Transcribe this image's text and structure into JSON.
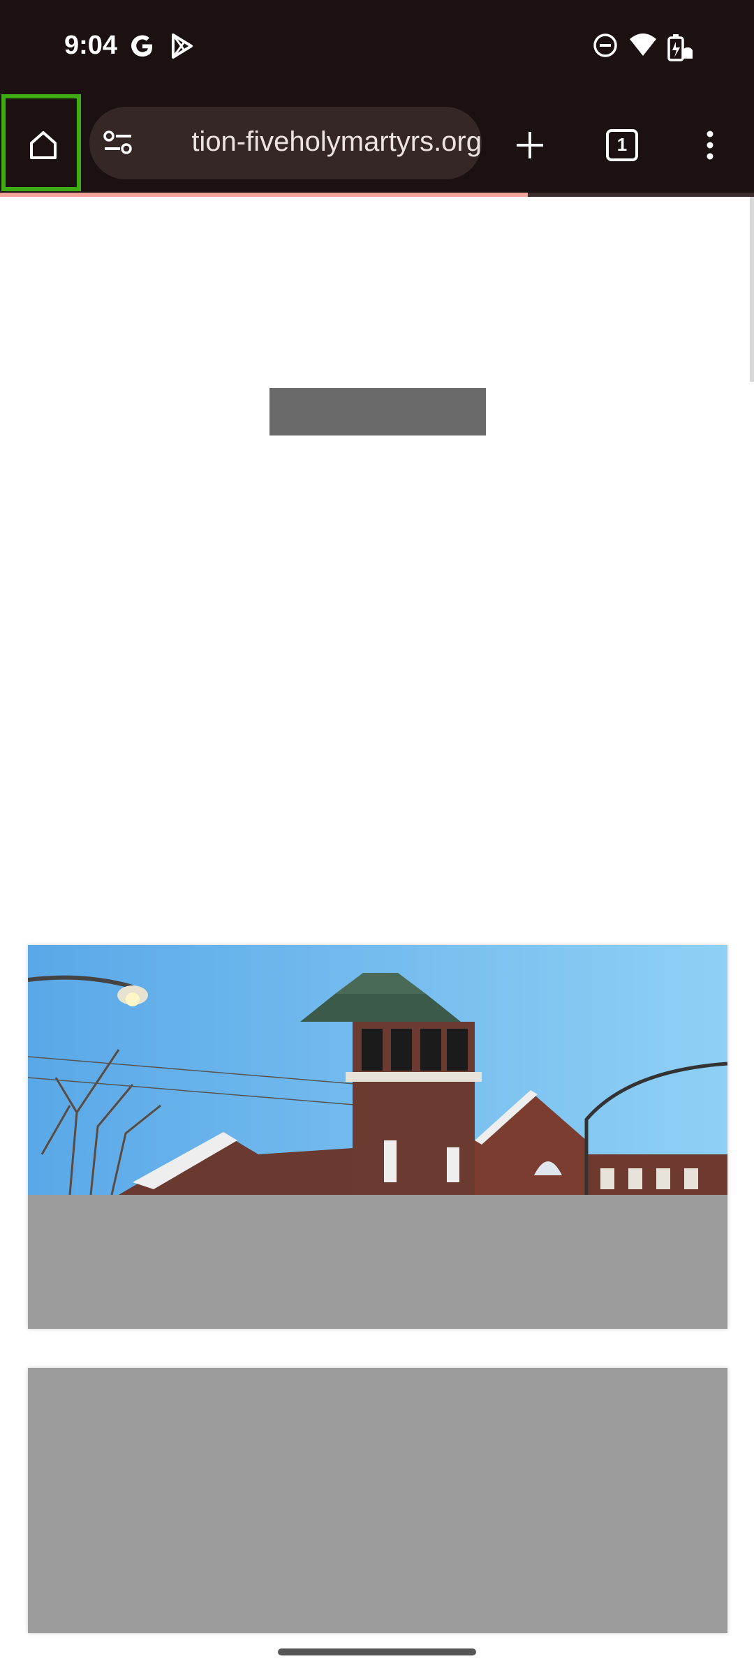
{
  "status_bar": {
    "time": "9:04",
    "icons": [
      "google-g-icon",
      "play-store-icon",
      "do-not-disturb-icon",
      "wifi-icon",
      "battery-charging-icon"
    ]
  },
  "toolbar": {
    "url": "tion-fiveholymartyrs.org",
    "tab_count": "1",
    "icons": [
      "home-icon",
      "page-info-icon",
      "new-tab-icon",
      "tab-switcher-icon",
      "more-options-icon"
    ]
  },
  "page": {
    "load_progress": 0.7,
    "hero_image": "church bell tower"
  },
  "colors": {
    "toolbar_bg": "#1b1110",
    "progress": "#f4a39b",
    "home_highlight": "#3eab15",
    "placeholder_gray": "#9b9b9b"
  }
}
